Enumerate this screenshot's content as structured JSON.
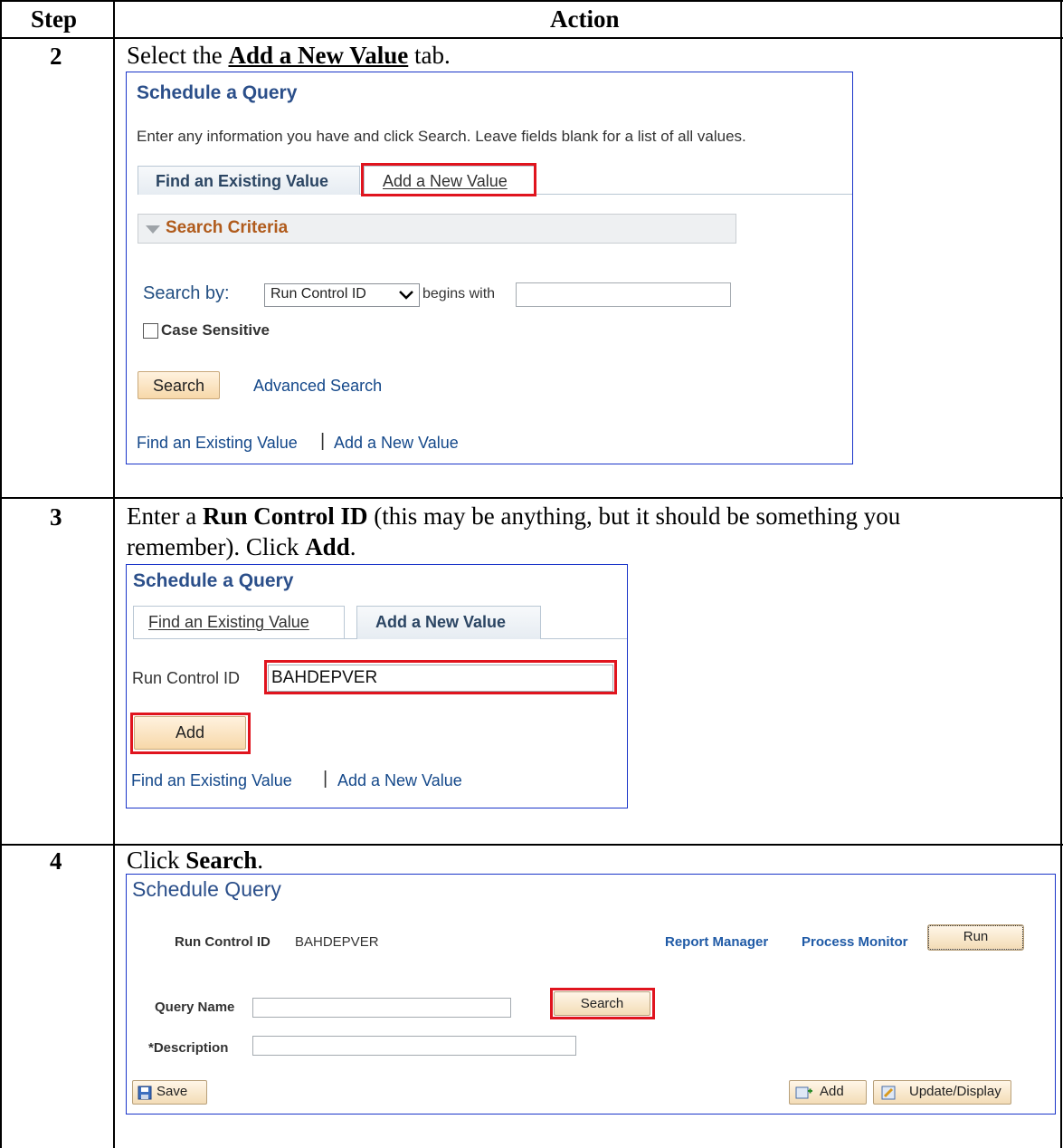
{
  "table": {
    "header_step": "Step",
    "header_action": "Action"
  },
  "steps": [
    {
      "number": "2",
      "instruction_pre": "Select the ",
      "instruction_bold": "Add a New Value",
      "instruction_post": " tab.",
      "screen": {
        "title": "Schedule a Query",
        "intro": "Enter any information you have and click Search. Leave fields blank for a list of all values.",
        "tab_find": "Find an Existing Value",
        "tab_add": "Add a New Value",
        "section": "Search Criteria",
        "search_by_label": "Search by:",
        "search_by_value": "Run Control ID",
        "operator": "begins with",
        "search_value": "",
        "case_sensitive": "Case Sensitive",
        "search_button": "Search",
        "advanced_search": "Advanced Search",
        "link_find": "Find an Existing Value",
        "link_sep": "|",
        "link_add": "Add a New Value"
      }
    },
    {
      "number": "3",
      "instruction_line1_pre": "Enter a ",
      "instruction_line1_bold": "Run Control ID",
      "instruction_line1_post": " (this may be anything, but it should be something you",
      "instruction_line2_pre": "remember).  Click ",
      "instruction_line2_bold": "Add",
      "instruction_line2_post": ".",
      "screen": {
        "title": "Schedule a Query",
        "tab_find": "Find an Existing Value",
        "tab_add": "Add a New Value",
        "run_control_label": "Run Control ID",
        "run_control_value": "BAHDEPVER",
        "add_button": "Add",
        "link_find": "Find an Existing Value",
        "link_sep": "|",
        "link_add": "Add a New Value"
      }
    },
    {
      "number": "4",
      "instruction_pre": "Click ",
      "instruction_bold": "Search",
      "instruction_post": ".",
      "screen": {
        "title": "Schedule Query",
        "run_control_label": "Run Control ID",
        "run_control_value": "BAHDEPVER",
        "report_manager": "Report Manager",
        "process_monitor": "Process Monitor",
        "run_button": "Run",
        "query_name_label": "Query Name",
        "query_name_value": "",
        "search_button": "Search",
        "description_label": "*Description",
        "description_value": "",
        "save_button": "Save",
        "add_button": "Add",
        "update_button": "Update/Display"
      }
    }
  ]
}
